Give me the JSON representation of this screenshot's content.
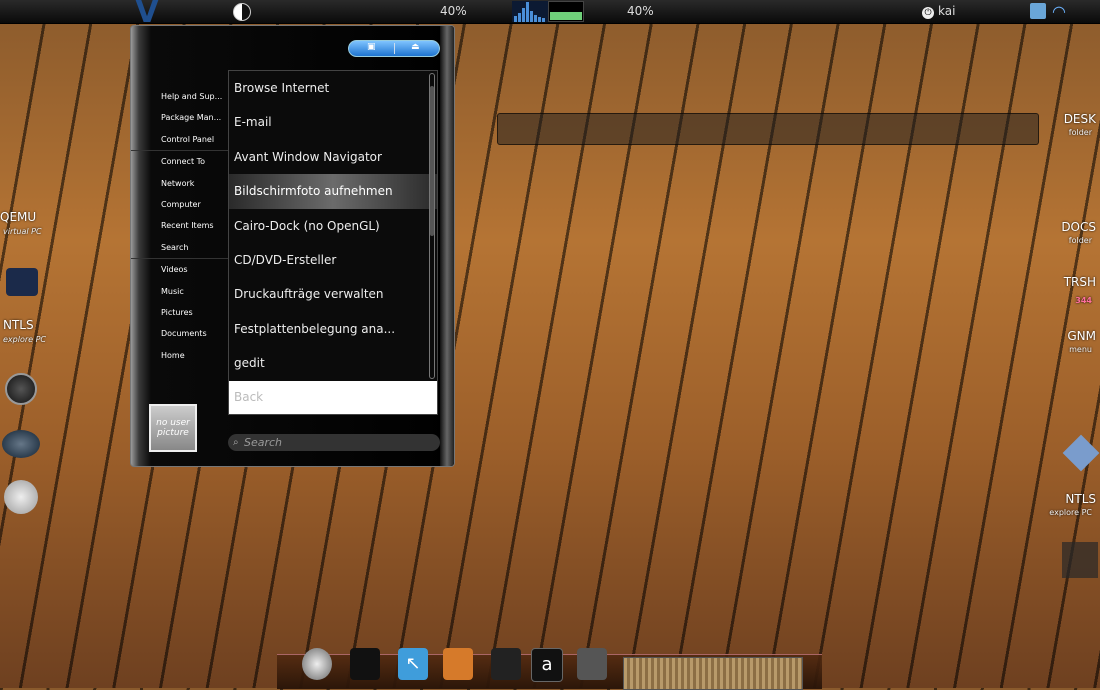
{
  "top_panel": {
    "cpu_percent": "40%",
    "mem_percent": "40%",
    "username": "kai",
    "mem_usage_fraction": 0.4
  },
  "menu": {
    "places": [
      "Help and Sup...",
      "Package Man...",
      "Control Panel",
      "Connect To",
      "Network",
      "Computer",
      "Recent Items",
      "Search",
      "Videos",
      "Music",
      "Pictures",
      "Documents",
      "Home"
    ],
    "avatar_text": "no user picture",
    "apps": [
      "Browse Internet",
      "E-mail",
      "Avant Window Navigator",
      "Bildschirmfoto aufnehmen",
      "Cairo-Dock (no OpenGL)",
      "CD/DVD-Ersteller",
      "Druckaufträge verwalten",
      "Festplattenbelegung ana...",
      "gedit"
    ],
    "highlighted_index": 3,
    "back_label": "Back",
    "search_placeholder": "Search"
  },
  "desktop_left": {
    "qemu_label": "QEMU",
    "qemu_sub": "virtual PC",
    "ntls_label": "NTLS",
    "ntls_sub": "explore PC"
  },
  "desktop_right": {
    "desk_label": "DESK",
    "desk_sub": "folder",
    "docs_label": "DOCS",
    "docs_sub": "folder",
    "trsh_label": "TRSH",
    "trsh_sub": "344",
    "gnm_label": "GNM",
    "gnm_sub": "menu",
    "ntls_label": "NTLS",
    "ntls_sub": "explore PC"
  }
}
